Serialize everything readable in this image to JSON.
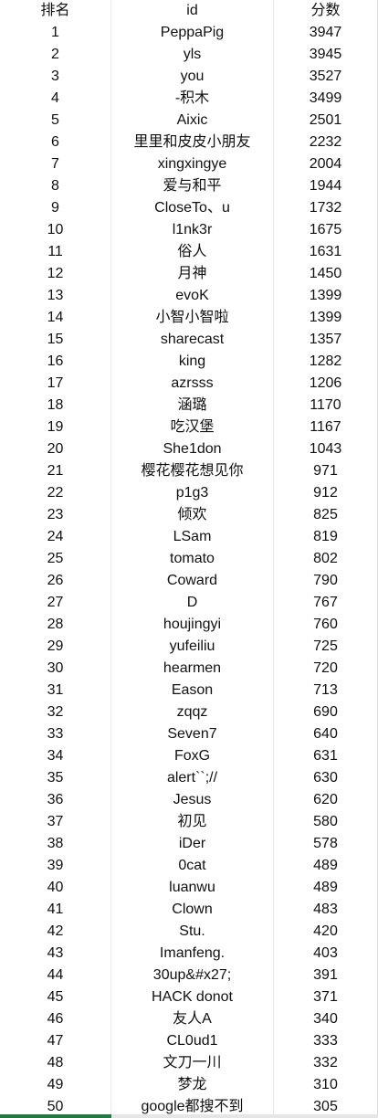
{
  "table": {
    "headers": [
      "排名",
      "id",
      "分数"
    ],
    "rows": [
      {
        "rank": "1",
        "id": "PeppaPig",
        "score": "3947"
      },
      {
        "rank": "2",
        "id": "yls",
        "score": "3945"
      },
      {
        "rank": "3",
        "id": "you",
        "score": "3527"
      },
      {
        "rank": "4",
        "id": "-积木",
        "score": "3499"
      },
      {
        "rank": "5",
        "id": "Aixic",
        "score": "2501"
      },
      {
        "rank": "6",
        "id": "里里和皮皮小朋友",
        "score": "2232"
      },
      {
        "rank": "7",
        "id": "xingxingye",
        "score": "2004"
      },
      {
        "rank": "8",
        "id": "爱与和平",
        "score": "1944"
      },
      {
        "rank": "9",
        "id": "CloseTo、u",
        "score": "1732"
      },
      {
        "rank": "10",
        "id": "l1nk3r",
        "score": "1675"
      },
      {
        "rank": "11",
        "id": "俗人",
        "score": "1631"
      },
      {
        "rank": "12",
        "id": "月神",
        "score": "1450"
      },
      {
        "rank": "13",
        "id": "evoK",
        "score": "1399"
      },
      {
        "rank": "14",
        "id": "小智小智啦",
        "score": "1399"
      },
      {
        "rank": "15",
        "id": "sharecast",
        "score": "1357"
      },
      {
        "rank": "16",
        "id": "king",
        "score": "1282"
      },
      {
        "rank": "17",
        "id": "azrsss",
        "score": "1206"
      },
      {
        "rank": "18",
        "id": "涵璐",
        "score": "1170"
      },
      {
        "rank": "19",
        "id": "吃汉堡",
        "score": "1167"
      },
      {
        "rank": "20",
        "id": "She1don",
        "score": "1043"
      },
      {
        "rank": "21",
        "id": "樱花樱花想见你",
        "score": "971"
      },
      {
        "rank": "22",
        "id": "p1g3",
        "score": "912"
      },
      {
        "rank": "23",
        "id": "倾欢",
        "score": "825"
      },
      {
        "rank": "24",
        "id": "LSam",
        "score": "819"
      },
      {
        "rank": "25",
        "id": "tomato",
        "score": "802"
      },
      {
        "rank": "26",
        "id": "Coward",
        "score": "790"
      },
      {
        "rank": "27",
        "id": "D",
        "score": "767"
      },
      {
        "rank": "28",
        "id": "houjingyi",
        "score": "760"
      },
      {
        "rank": "29",
        "id": "yufeiliu",
        "score": "725"
      },
      {
        "rank": "30",
        "id": "hearmen",
        "score": "720"
      },
      {
        "rank": "31",
        "id": "Eason",
        "score": "713"
      },
      {
        "rank": "32",
        "id": "zqqz",
        "score": "690"
      },
      {
        "rank": "33",
        "id": "Seven7",
        "score": "640"
      },
      {
        "rank": "34",
        "id": "FoxG",
        "score": "631"
      },
      {
        "rank": "35",
        "id": "alert``;//",
        "score": "630"
      },
      {
        "rank": "36",
        "id": "Jesus",
        "score": "620"
      },
      {
        "rank": "37",
        "id": "初见",
        "score": "580"
      },
      {
        "rank": "38",
        "id": "iDer",
        "score": "578"
      },
      {
        "rank": "39",
        "id": "0cat",
        "score": "489"
      },
      {
        "rank": "40",
        "id": "luanwu",
        "score": "489"
      },
      {
        "rank": "41",
        "id": "Clown",
        "score": "483"
      },
      {
        "rank": "42",
        "id": "Stu.",
        "score": "420"
      },
      {
        "rank": "43",
        "id": "Imanfeng.",
        "score": "403"
      },
      {
        "rank": "44",
        "id": "30up&#x27;",
        "score": "391"
      },
      {
        "rank": "45",
        "id": "HACK donot",
        "score": "371"
      },
      {
        "rank": "46",
        "id": "友人A",
        "score": "340"
      },
      {
        "rank": "47",
        "id": "CL0ud1",
        "score": "333"
      },
      {
        "rank": "48",
        "id": "文刀一川",
        "score": "332"
      },
      {
        "rank": "49",
        "id": "梦龙",
        "score": "310"
      },
      {
        "rank": "50",
        "id": "google都搜不到",
        "score": "305"
      }
    ]
  },
  "colors": {
    "active_sheet_tab": "#1f7a3f",
    "tab_strip": "#e6e6e6"
  }
}
